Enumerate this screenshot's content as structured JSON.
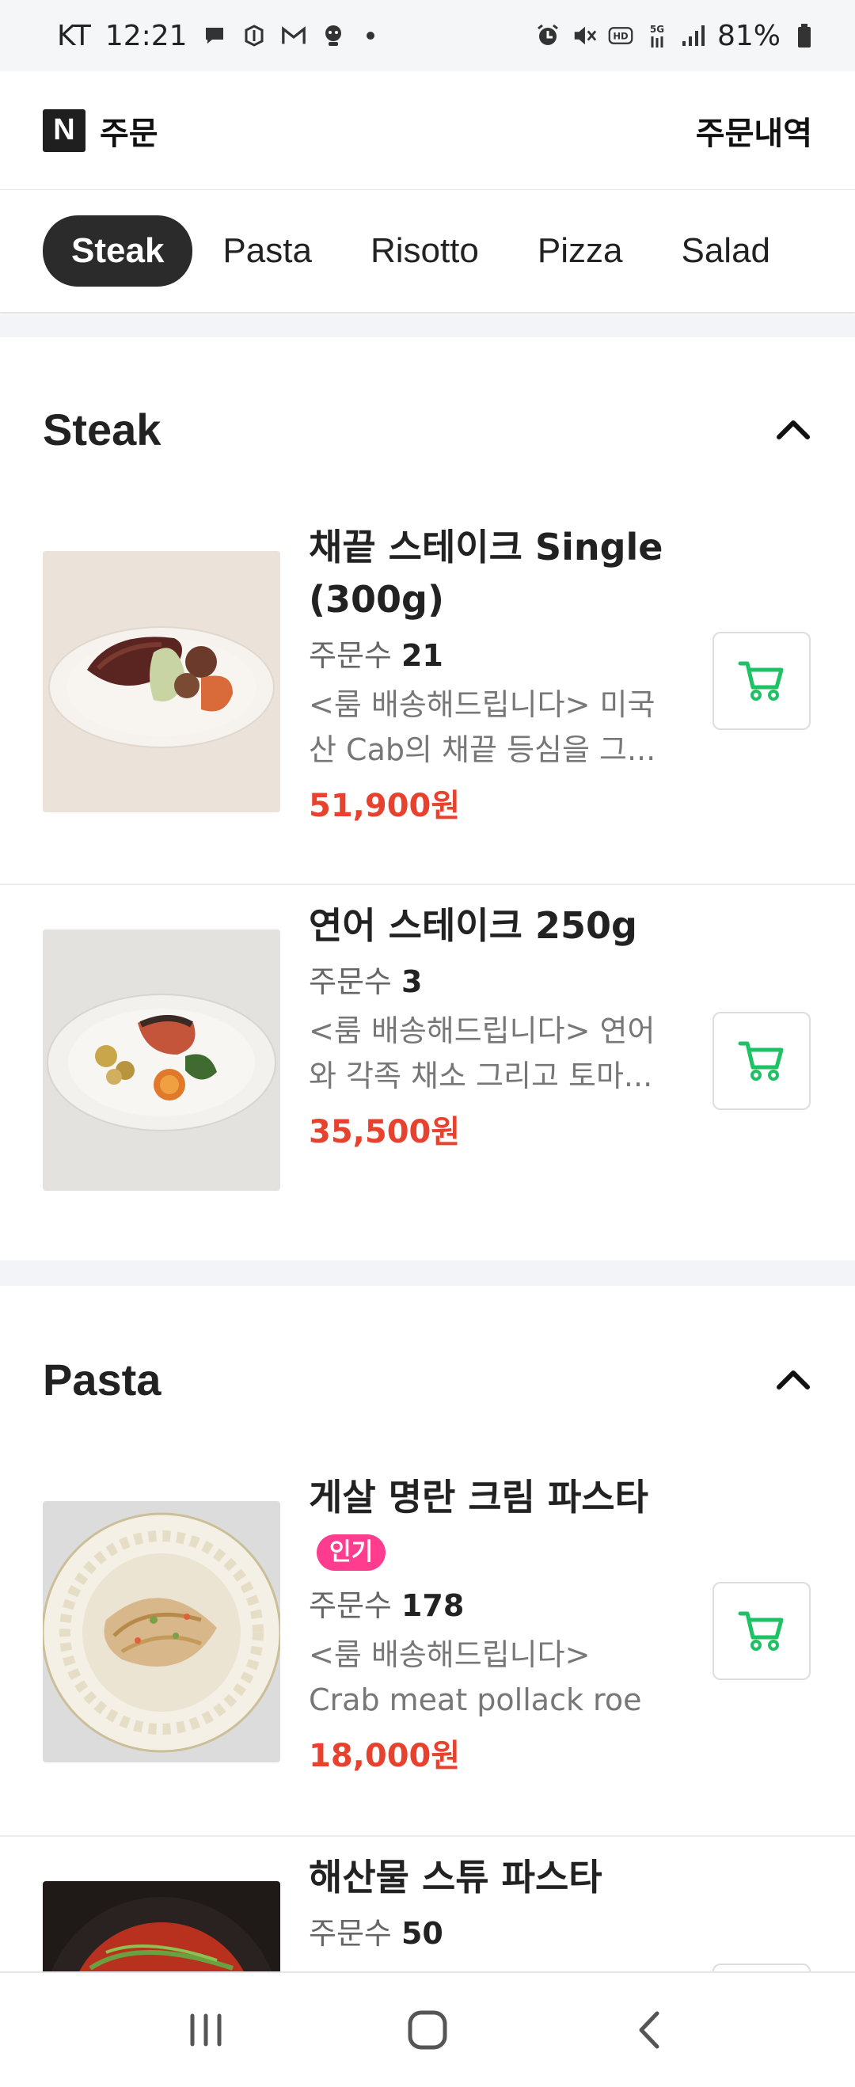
{
  "status_bar": {
    "carrier": "KT",
    "time": "12:21",
    "battery": "81%",
    "left_icons": [
      "chat-icon",
      "shield-app-icon",
      "mail-icon",
      "face-app-icon"
    ],
    "right_icons": [
      "alarm-icon",
      "mute-icon",
      "hd-icon",
      "5g-icon",
      "signal-icon",
      "battery-icon"
    ]
  },
  "header": {
    "logo": "N",
    "title": "주문",
    "history_link": "주문내역"
  },
  "tabs": [
    {
      "label": "Steak",
      "active": true
    },
    {
      "label": "Pasta",
      "active": false
    },
    {
      "label": "Risotto",
      "active": false
    },
    {
      "label": "Pizza",
      "active": false
    },
    {
      "label": "Salad",
      "active": false
    }
  ],
  "sections": [
    {
      "title": "Steak",
      "items": [
        {
          "name": "채끝 스테이크 Single (300g)",
          "badge": "",
          "orders_label": "주문수",
          "orders": "21",
          "desc": "<룸 배송해드립니다> 미국산 Cab의 채끝 등심을 그...",
          "price": "51,900원"
        },
        {
          "name": "연어 스테이크 250g",
          "badge": "",
          "orders_label": "주문수",
          "orders": "3",
          "desc": "<룸 배송해드립니다> 연어와 각족 채소 그리고 토마...",
          "price": "35,500원"
        }
      ]
    },
    {
      "title": "Pasta",
      "items": [
        {
          "name": "게살 명란 크림 파스타",
          "badge": "인기",
          "orders_label": "주문수",
          "orders": "178",
          "desc": "<룸 배송해드립니다> Crab meat pollack roe cream...",
          "price": "18,000원"
        },
        {
          "name": "해산물 스튜 파스타",
          "badge": "",
          "orders_label": "주문수",
          "orders": "50",
          "desc": "",
          "price": ""
        }
      ]
    }
  ],
  "colors": {
    "accent_price": "#e8422e",
    "cart_green": "#1ec265",
    "badge_pink": "#ff3c8d",
    "active_tab": "#2b2b2b"
  },
  "nav": [
    "recent-apps-icon",
    "home-icon",
    "back-icon"
  ]
}
